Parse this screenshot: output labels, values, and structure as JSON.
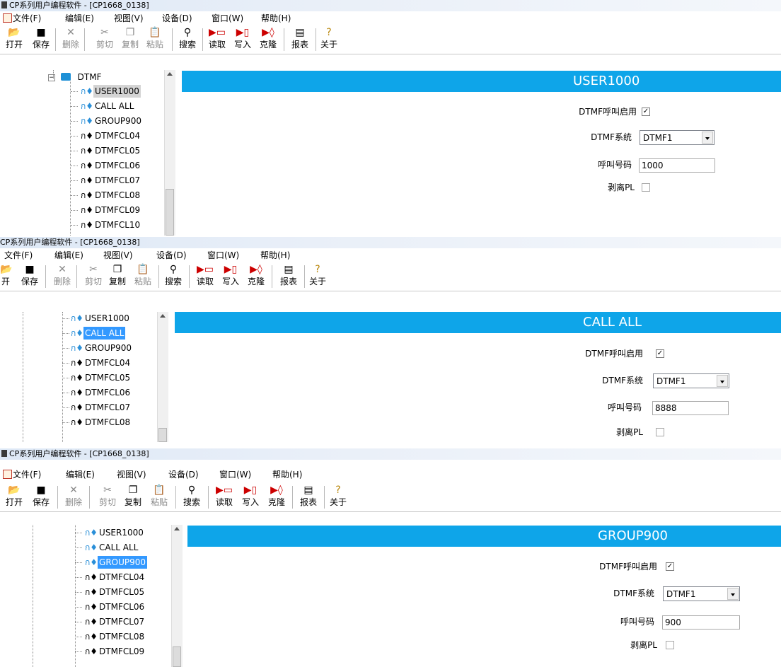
{
  "colors": {
    "header_bg": "#0ea5e9",
    "selection_blue": "#3399ff",
    "selection_gray": "#d4d4d4"
  },
  "panels": [
    {
      "title": "CP系列用户编程软件 - [CP1668_0138]",
      "menu": [
        "文件(F)",
        "编辑(E)",
        "视图(V)",
        "设备(D)",
        "窗口(W)",
        "帮助(H)"
      ],
      "toolbar": {
        "open": "打开",
        "save": "保存",
        "delete": "删除",
        "cut": "剪切",
        "copy": "复制",
        "paste": "粘贴",
        "search": "搜索",
        "read": "读取",
        "write": "写入",
        "clone": "克隆",
        "report": "报表",
        "about": "关于"
      },
      "tree": {
        "folder": "DTMF",
        "items": [
          "USER1000",
          "CALL ALL",
          "GROUP900",
          "DTMFCL04",
          "DTMFCL05",
          "DTMFCL06",
          "DTMFCL07",
          "DTMFCL08",
          "DTMFCL09",
          "DTMFCL10"
        ],
        "selected": "USER1000"
      },
      "detail": {
        "header": "USER1000",
        "enable_label": "DTMF呼叫启用",
        "enable_checked": true,
        "system_label": "DTMF系统",
        "system_value": "DTMF1",
        "number_label": "呼叫号码",
        "number_value": "1000",
        "strip_label": "剥离PL",
        "strip_checked": false
      }
    },
    {
      "title": "CP系列用户编程软件 - [CP1668_0138]",
      "menu": [
        "文件(F)",
        "编辑(E)",
        "视图(V)",
        "设备(D)",
        "窗口(W)",
        "帮助(H)"
      ],
      "toolbar": {
        "open": "开",
        "save": "保存",
        "delete": "删除",
        "cut": "剪切",
        "copy": "复制",
        "paste": "粘贴",
        "search": "搜索",
        "read": "读取",
        "write": "写入",
        "clone": "克隆",
        "report": "报表",
        "about": "关于"
      },
      "tree": {
        "items": [
          "USER1000",
          "CALL ALL",
          "GROUP900",
          "DTMFCL04",
          "DTMFCL05",
          "DTMFCL06",
          "DTMFCL07",
          "DTMFCL08"
        ],
        "selected": "CALL ALL"
      },
      "detail": {
        "header": "CALL ALL",
        "enable_label": "DTMF呼叫启用",
        "enable_checked": true,
        "system_label": "DTMF系统",
        "system_value": "DTMF1",
        "number_label": "呼叫号码",
        "number_value": "8888",
        "strip_label": "剥离PL",
        "strip_checked": false
      }
    },
    {
      "title": "CP系列用户编程软件 - [CP1668_0138]",
      "menu": [
        "文件(F)",
        "编辑(E)",
        "视图(V)",
        "设备(D)",
        "窗口(W)",
        "帮助(H)"
      ],
      "toolbar": {
        "open": "打开",
        "save": "保存",
        "delete": "删除",
        "cut": "剪切",
        "copy": "复制",
        "paste": "粘贴",
        "search": "搜索",
        "read": "读取",
        "write": "写入",
        "clone": "克隆",
        "report": "报表",
        "about": "关于"
      },
      "tree": {
        "items": [
          "USER1000",
          "CALL ALL",
          "GROUP900",
          "DTMFCL04",
          "DTMFCL05",
          "DTMFCL06",
          "DTMFCL07",
          "DTMFCL08",
          "DTMFCL09"
        ],
        "selected": "GROUP900"
      },
      "detail": {
        "header": "GROUP900",
        "enable_label": "DTMF呼叫启用",
        "enable_checked": true,
        "system_label": "DTMF系统",
        "system_value": "DTMF1",
        "number_label": "呼叫号码",
        "number_value": "900",
        "strip_label": "剥离PL",
        "strip_checked": false
      }
    }
  ]
}
